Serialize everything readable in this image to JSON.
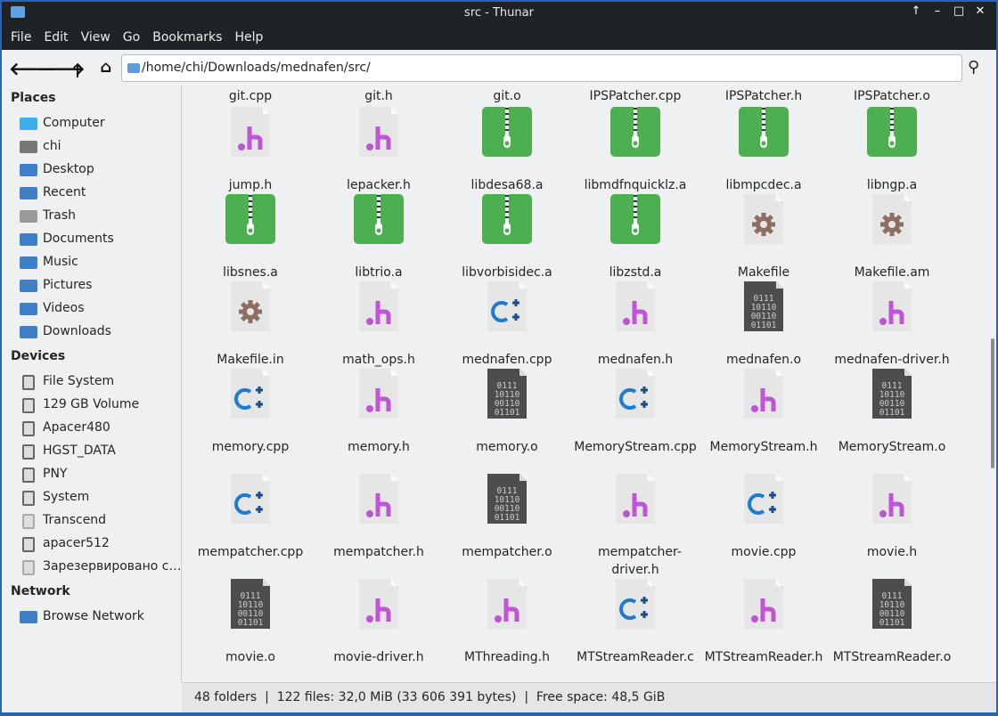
{
  "window": {
    "title": "src - Thunar"
  },
  "menu": [
    "File",
    "Edit",
    "View",
    "Go",
    "Bookmarks",
    "Help"
  ],
  "address": "/home/chi/Downloads/mednafen/src/",
  "sidebar": {
    "places_title": "Places",
    "places": [
      {
        "label": "Computer",
        "icon": "computer"
      },
      {
        "label": "chi",
        "icon": "home"
      },
      {
        "label": "Desktop",
        "icon": "folder"
      },
      {
        "label": "Recent",
        "icon": "folder"
      },
      {
        "label": "Trash",
        "icon": "trash"
      },
      {
        "label": "Documents",
        "icon": "folder"
      },
      {
        "label": "Music",
        "icon": "folder"
      },
      {
        "label": "Pictures",
        "icon": "folder"
      },
      {
        "label": "Videos",
        "icon": "folder"
      },
      {
        "label": "Downloads",
        "icon": "folder"
      }
    ],
    "devices_title": "Devices",
    "devices": [
      {
        "label": "File System",
        "icon": "drive"
      },
      {
        "label": "129 GB Volume",
        "icon": "drive"
      },
      {
        "label": "Apacer480",
        "icon": "drive"
      },
      {
        "label": "HGST_DATA",
        "icon": "drive"
      },
      {
        "label": "PNY",
        "icon": "drive"
      },
      {
        "label": "System",
        "icon": "drive"
      },
      {
        "label": "Transcend",
        "icon": "drive-unmounted"
      },
      {
        "label": "apacer512",
        "icon": "drive"
      },
      {
        "label": "Зарезервировано системой",
        "icon": "drive-unmounted"
      }
    ],
    "network_title": "Network",
    "network": [
      {
        "label": "Browse Network",
        "icon": "network"
      }
    ]
  },
  "files": [
    {
      "name": "git.cpp",
      "type": "cpp"
    },
    {
      "name": "git.h",
      "type": "h"
    },
    {
      "name": "git.o",
      "type": "o"
    },
    {
      "name": "IPSPatcher.cpp",
      "type": "cpp"
    },
    {
      "name": "IPSPatcher.h",
      "type": "h"
    },
    {
      "name": "IPSPatcher.o",
      "type": "o"
    },
    {
      "name": "jump.h",
      "type": "h"
    },
    {
      "name": "lepacker.h",
      "type": "h"
    },
    {
      "name": "libdesa68.a",
      "type": "a"
    },
    {
      "name": "libmdfnquicklz.a",
      "type": "a"
    },
    {
      "name": "libmpcdec.a",
      "type": "a"
    },
    {
      "name": "libngp.a",
      "type": "a"
    },
    {
      "name": "libsnes.a",
      "type": "a"
    },
    {
      "name": "libtrio.a",
      "type": "a"
    },
    {
      "name": "libvorbisidec.a",
      "type": "a"
    },
    {
      "name": "libzstd.a",
      "type": "a"
    },
    {
      "name": "Makefile",
      "type": "make"
    },
    {
      "name": "Makefile.am",
      "type": "make"
    },
    {
      "name": "Makefile.in",
      "type": "make"
    },
    {
      "name": "math_ops.h",
      "type": "h"
    },
    {
      "name": "mednafen.cpp",
      "type": "cpp"
    },
    {
      "name": "mednafen.h",
      "type": "h"
    },
    {
      "name": "mednafen.o",
      "type": "o"
    },
    {
      "name": "mednafen-driver.h",
      "type": "h"
    },
    {
      "name": "memory.cpp",
      "type": "cpp"
    },
    {
      "name": "memory.h",
      "type": "h"
    },
    {
      "name": "memory.o",
      "type": "o"
    },
    {
      "name": "MemoryStream.cpp",
      "type": "cpp"
    },
    {
      "name": "MemoryStream.h",
      "type": "h"
    },
    {
      "name": "MemoryStream.o",
      "type": "o"
    },
    {
      "name": "mempatcher.cpp",
      "type": "cpp"
    },
    {
      "name": "mempatcher.h",
      "type": "h"
    },
    {
      "name": "mempatcher.o",
      "type": "o"
    },
    {
      "name": "mempatcher-driver.h",
      "type": "h"
    },
    {
      "name": "movie.cpp",
      "type": "cpp"
    },
    {
      "name": "movie.h",
      "type": "h"
    },
    {
      "name": "movie.o",
      "type": "o"
    },
    {
      "name": "movie-driver.h",
      "type": "h"
    },
    {
      "name": "MThreading.h",
      "type": "h"
    },
    {
      "name": "MTStreamReader.c",
      "type": "cpp"
    },
    {
      "name": "MTStreamReader.h",
      "type": "h"
    },
    {
      "name": "MTStreamReader.o",
      "type": "o"
    }
  ],
  "status": "48 folders  |  122 files: 32,0 MiB (33 606 391 bytes)  |  Free space: 48,5 GiB",
  "colors": {
    "archive": "#4caf50",
    "header": "#c054d6",
    "cpp": "#1d7ccf",
    "object": "#4d4d4d",
    "gear": "#8d6e63"
  }
}
